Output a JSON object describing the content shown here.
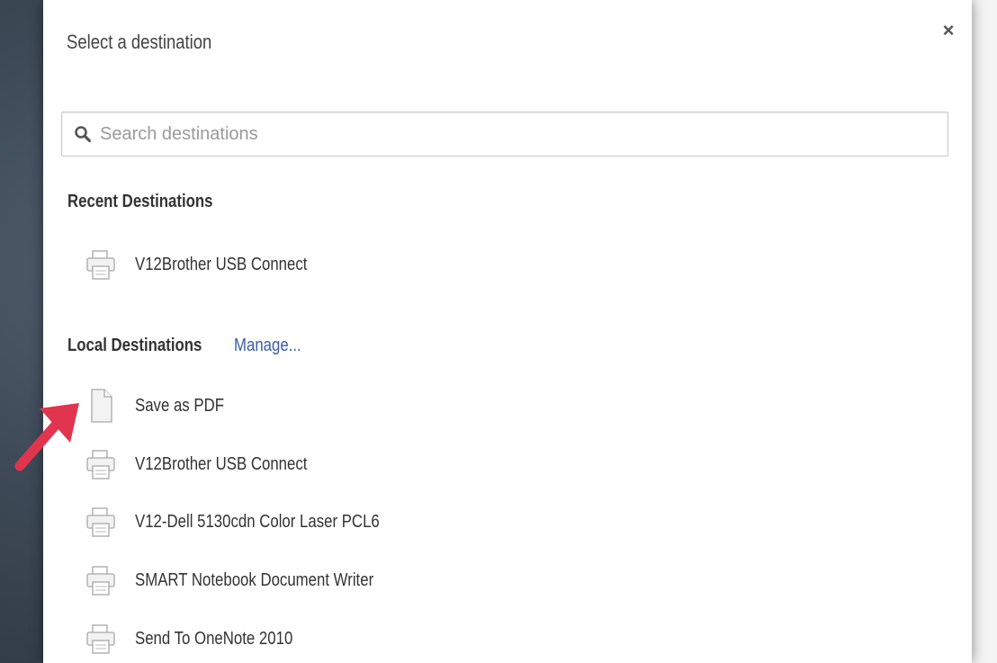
{
  "dialog": {
    "title": "Select a destination",
    "close_label": "×"
  },
  "search": {
    "placeholder": "Search destinations",
    "value": ""
  },
  "recent": {
    "heading": "Recent Destinations",
    "items": [
      {
        "label": "V12Brother USB Connect",
        "icon": "printer-icon"
      }
    ]
  },
  "local": {
    "heading": "Local Destinations",
    "manage_label": "Manage...",
    "items": [
      {
        "label": "Save as PDF",
        "icon": "document-icon"
      },
      {
        "label": "V12Brother USB Connect",
        "icon": "printer-icon"
      },
      {
        "label": "V12-Dell 5130cdn Color Laser PCL6",
        "icon": "printer-icon"
      },
      {
        "label": "SMART Notebook Document Writer",
        "icon": "printer-icon"
      },
      {
        "label": "Send To OneNote 2010",
        "icon": "printer-icon"
      }
    ]
  },
  "colors": {
    "link": "#3b5ea8",
    "annotation_arrow": "#e0344f",
    "background": "#3e4a57"
  }
}
